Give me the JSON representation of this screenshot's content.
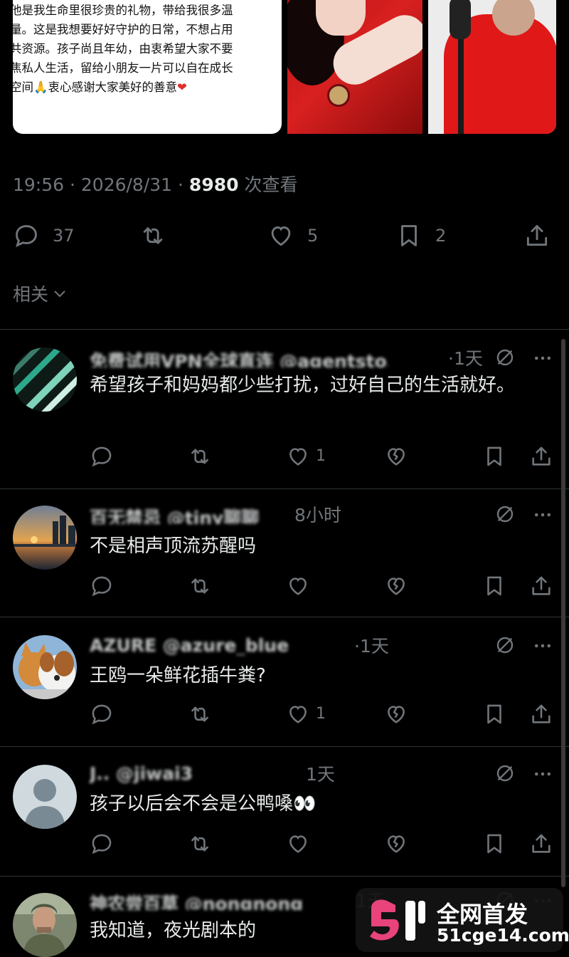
{
  "post": {
    "quote_lines": [
      "他是我生命里很珍贵的礼物，带给我很多温",
      "量。这是我想要好好守护的日常，不想占用",
      "共资源。孩子尚且年幼，由衷希望大家不要",
      "焦私人生活，留给小朋友一片可以自在成长",
      "空间🙏衷心感谢大家美好的善意"
    ],
    "quote_heart": "❤",
    "timestamp": "19:56 · 2026/8/31 · ",
    "views": "8980",
    "views_suffix": " 次查看",
    "actions": {
      "reply_count": "37",
      "like_count": "5",
      "bookmark_count": "2"
    },
    "related_label": "相关"
  },
  "replies": [
    {
      "name": "免费试用VPN全球直连 @agentsto3",
      "time": "·1天",
      "text": "希望孩子和妈妈都少些打扰，过好自己的生活就好。",
      "like_count": "1",
      "avatar": "teal-stripe-avatar"
    },
    {
      "name": "百无禁忌 @tiny聊聊",
      "time": "8小时",
      "text": "不是相声顶流苏醒吗",
      "like_count": "",
      "avatar": "sunset-skyline-avatar"
    },
    {
      "name": "AZURE @azure_blue",
      "time": "·1天",
      "text": "王鸥一朵鲜花插牛粪?",
      "like_count": "1",
      "avatar": "cat-dog-avatar"
    },
    {
      "name": "J.. @jiwai3",
      "time": "1天",
      "text": "孩子以后会不会是公鸭嗓👀",
      "like_count": "",
      "avatar": "default-user-avatar"
    },
    {
      "name": "神农尝百草 @nongnong",
      "time": "1天",
      "text": "我知道，夜光剧本的",
      "like_count": "",
      "avatar": "soldier-photo-avatar"
    }
  ],
  "watermark": {
    "line1": "全网首发",
    "line2": "51cge14.com",
    "colors": {
      "pink": "#e8437a",
      "white": "#ffffff"
    }
  },
  "colors": {
    "bg": "#000000",
    "text": "#e7e9ea",
    "muted": "#71767b",
    "divider": "#2f3336"
  }
}
